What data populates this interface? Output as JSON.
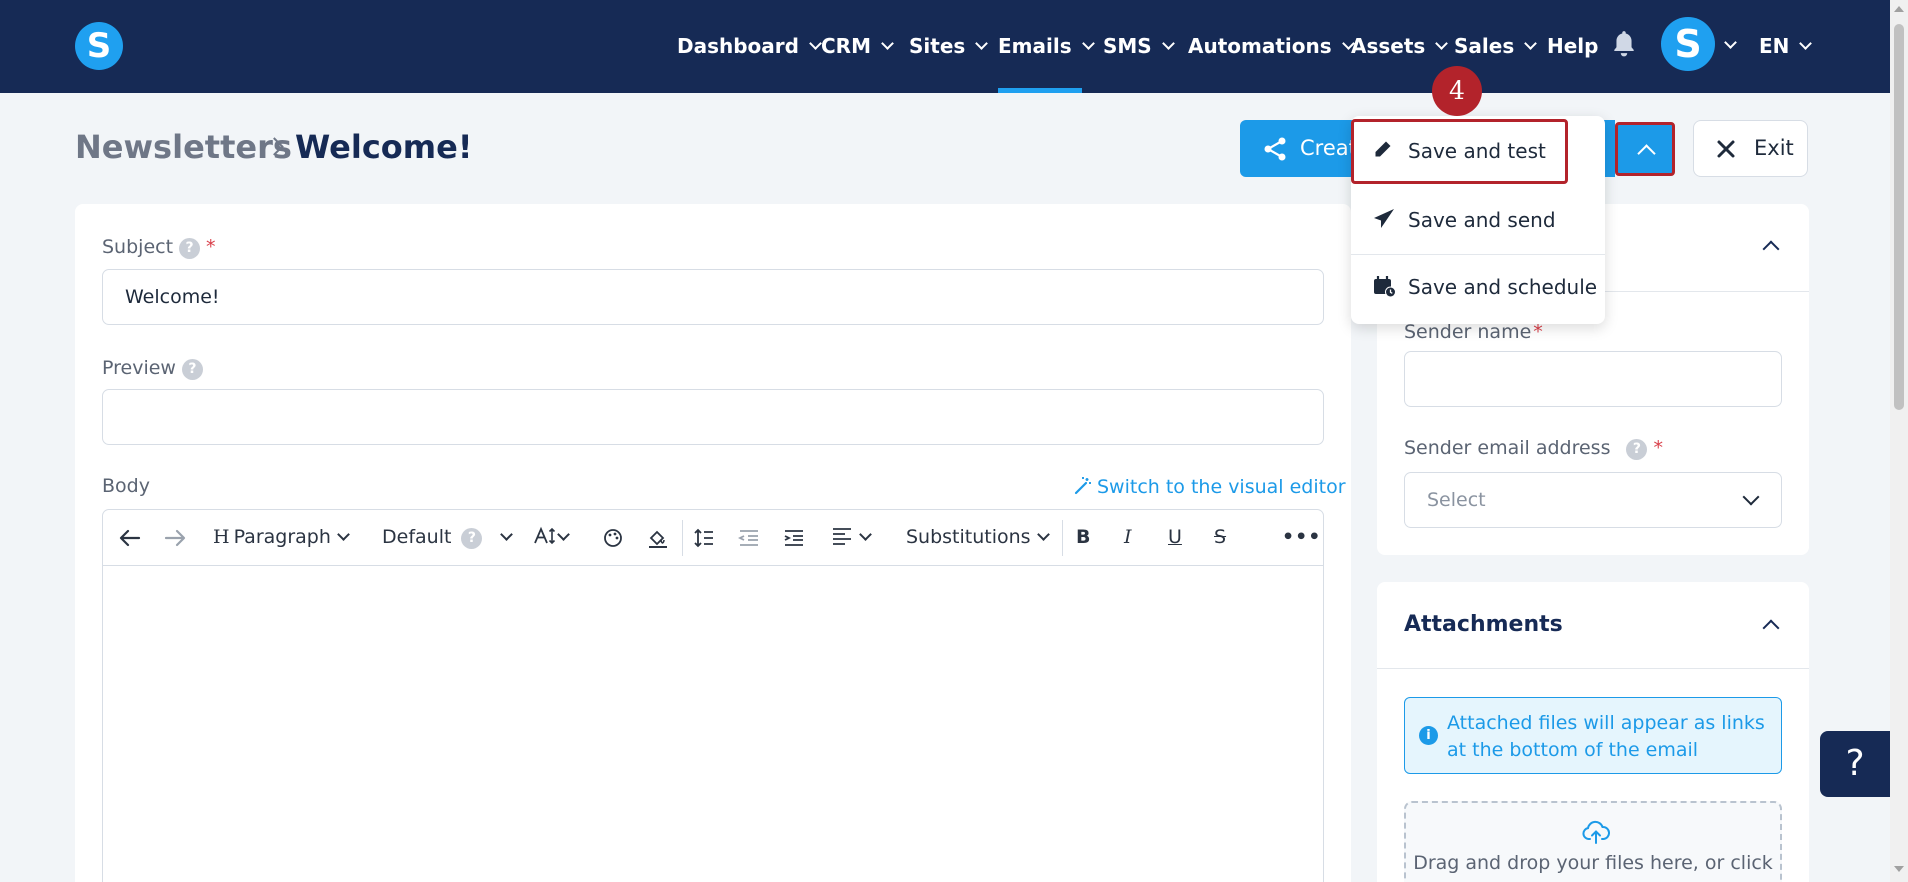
{
  "nav": {
    "logo": "S",
    "items": [
      {
        "label": "Dashboard",
        "has_menu": true
      },
      {
        "label": "CRM",
        "has_menu": true
      },
      {
        "label": "Sites",
        "has_menu": true
      },
      {
        "label": "Emails",
        "has_menu": true,
        "active": true
      },
      {
        "label": "SMS",
        "has_menu": true
      },
      {
        "label": "Automations",
        "has_menu": true
      },
      {
        "label": "Assets",
        "has_menu": true
      },
      {
        "label": "Sales",
        "has_menu": true
      },
      {
        "label": "Help",
        "has_menu": false
      }
    ],
    "avatar_letter": "S",
    "language": "EN"
  },
  "breadcrumb": {
    "parent": "Newsletters",
    "current": "Welcome!"
  },
  "header_buttons": {
    "create_label": "Create",
    "exit_label": "Exit"
  },
  "dropdown": {
    "step_badge": "4",
    "items": [
      {
        "label": "Save and test",
        "icon": "pencil-icon"
      },
      {
        "label": "Save and send",
        "icon": "paper-plane-icon"
      },
      {
        "label": "Save and schedule",
        "icon": "calendar-clock-icon"
      }
    ]
  },
  "form": {
    "subject_label": "Subject",
    "subject_value": "Welcome!",
    "preview_label": "Preview",
    "preview_value": "",
    "body_label": "Body",
    "switch_editor_label": "Switch to the visual editor",
    "help_glyph": "?",
    "required_mark": "*"
  },
  "toolbar": {
    "paragraph": "Paragraph",
    "paragraph_glyph": "H",
    "font": "Default",
    "substitutions": "Substitutions",
    "bold": "B",
    "italic": "I",
    "underline": "U",
    "strike": "S",
    "more": "•••"
  },
  "sender": {
    "name_label": "Sender name",
    "email_label": "Sender email address",
    "email_placeholder": "Select"
  },
  "attachments": {
    "title": "Attachments",
    "info": "Attached files will appear as links at the bottom of the email",
    "info_glyph": "i",
    "dropzone_text": "Drag and drop your files here, or click"
  },
  "help_float": "?",
  "colors": {
    "nav_bg": "#162a55",
    "accent": "#1c9ae8",
    "highlight": "#b3232b"
  }
}
